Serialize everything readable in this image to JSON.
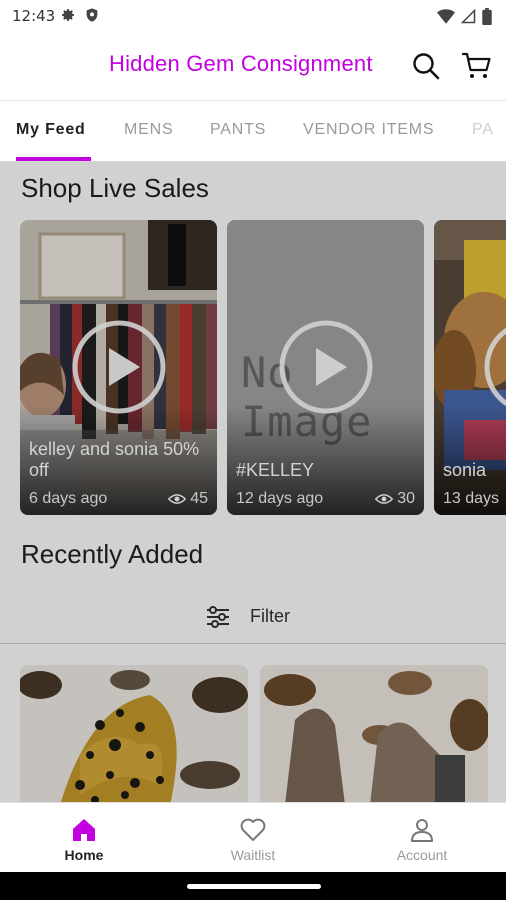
{
  "status_bar": {
    "time": "12:43"
  },
  "header": {
    "title": "Hidden Gem Consignment"
  },
  "tabs": [
    {
      "label": "My Feed",
      "active": true
    },
    {
      "label": "MENS",
      "active": false
    },
    {
      "label": "PANTS",
      "active": false
    },
    {
      "label": "VENDOR ITEMS",
      "active": false
    },
    {
      "label": "PA",
      "active": false
    }
  ],
  "live_sales": {
    "title": "Shop Live Sales",
    "cards": [
      {
        "name": "kelley and sonia 50% off",
        "time": "6 days ago",
        "views": "45"
      },
      {
        "name": "#KELLEY",
        "time": "12 days ago",
        "views": "30",
        "placeholder_text": "No Image"
      },
      {
        "name": "sonia",
        "time": "13 days"
      }
    ]
  },
  "recently_added": {
    "title": "Recently Added",
    "filter_label": "Filter"
  },
  "bottom_nav": [
    {
      "label": "Home",
      "icon": "home-icon",
      "active": true
    },
    {
      "label": "Waitlist",
      "icon": "heart-icon",
      "active": false
    },
    {
      "label": "Account",
      "icon": "person-icon",
      "active": false
    }
  ],
  "colors": {
    "brand": "#c200e0",
    "text": "#222222",
    "inactive": "#9a9a9a"
  }
}
